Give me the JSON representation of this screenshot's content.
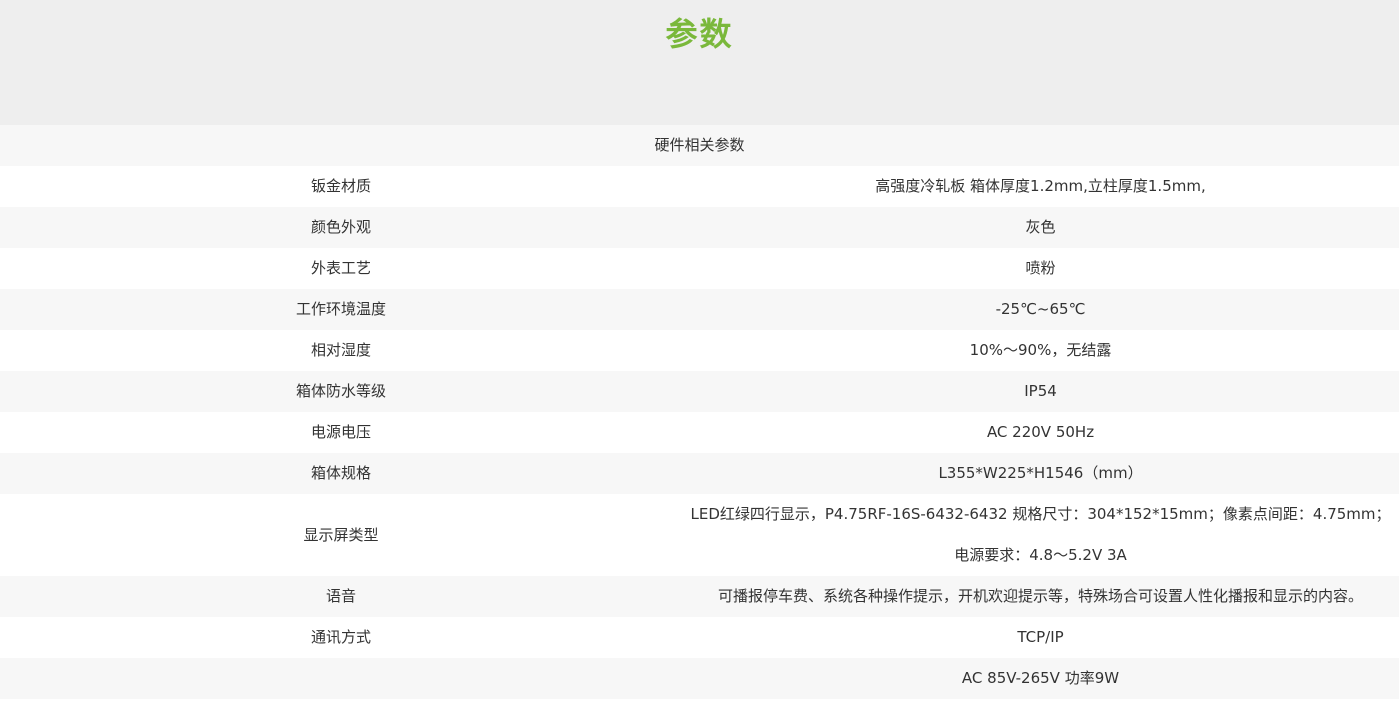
{
  "header": {
    "title": "参数"
  },
  "section": {
    "title": "硬件相关参数"
  },
  "rows": [
    {
      "label": "钣金材质",
      "value": "高强度冷轧板 箱体厚度1.2mm,立柱厚度1.5mm,"
    },
    {
      "label": "颜色外观",
      "value": "灰色"
    },
    {
      "label": "外表工艺",
      "value": "喷粉"
    },
    {
      "label": "工作环境温度",
      "value": "-25℃~65℃"
    },
    {
      "label": "相对湿度",
      "value": "10%～90%，无结露"
    },
    {
      "label": "箱体防水等级",
      "value": "IP54"
    },
    {
      "label": "电源电压",
      "value": "AC  220V  50Hz"
    },
    {
      "label": "箱体规格",
      "value": "L355*W225*H1546（mm）"
    },
    {
      "label": "显示屏类型",
      "value_lines": [
        "LED红绿四行显示，P4.75RF-16S-6432-6432 规格尺寸：304*152*15mm；像素点间距：4.75mm；",
        "电源要求：4.8～5.2V 3A"
      ]
    },
    {
      "label": "语音",
      "value": "可播报停车费、系统各种操作提示，开机欢迎提示等，特殊场合可设置人性化播报和显示的内容。"
    },
    {
      "label": "通讯方式",
      "value": "TCP/IP"
    },
    {
      "label": "",
      "value": "AC 85V-265V  功率9W"
    }
  ]
}
